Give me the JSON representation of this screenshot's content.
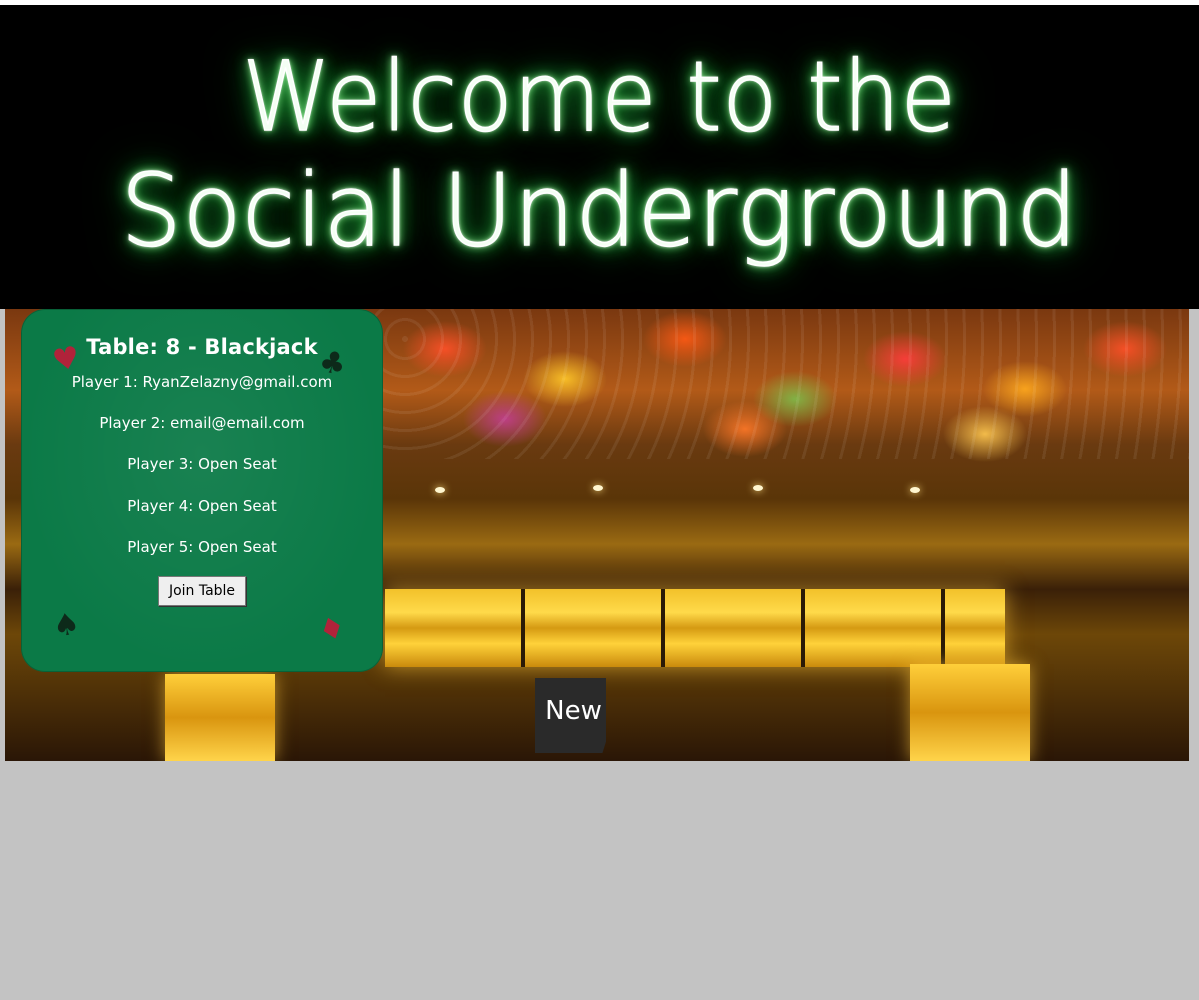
{
  "header": {
    "title_line1": "Welcome to the",
    "title_line2": "Social Underground"
  },
  "table_card": {
    "title": "Table: 8 - Blackjack",
    "players": [
      "Player 1: RyanZelazny@gmail.com",
      "Player 2: email@email.com",
      "Player 3: Open Seat",
      "Player 4: Open Seat",
      "Player 5: Open Seat"
    ],
    "join_label": "Join Table",
    "suits": {
      "heart": "♥",
      "club": "♣",
      "spade": "♠",
      "diamond": "♦"
    }
  },
  "new_label": "New",
  "colors": {
    "neon_glow": "#2fdc4f",
    "felt": "#0b7a47",
    "page_background": "#c3c3c3",
    "new_button": "#2a2a2a"
  }
}
